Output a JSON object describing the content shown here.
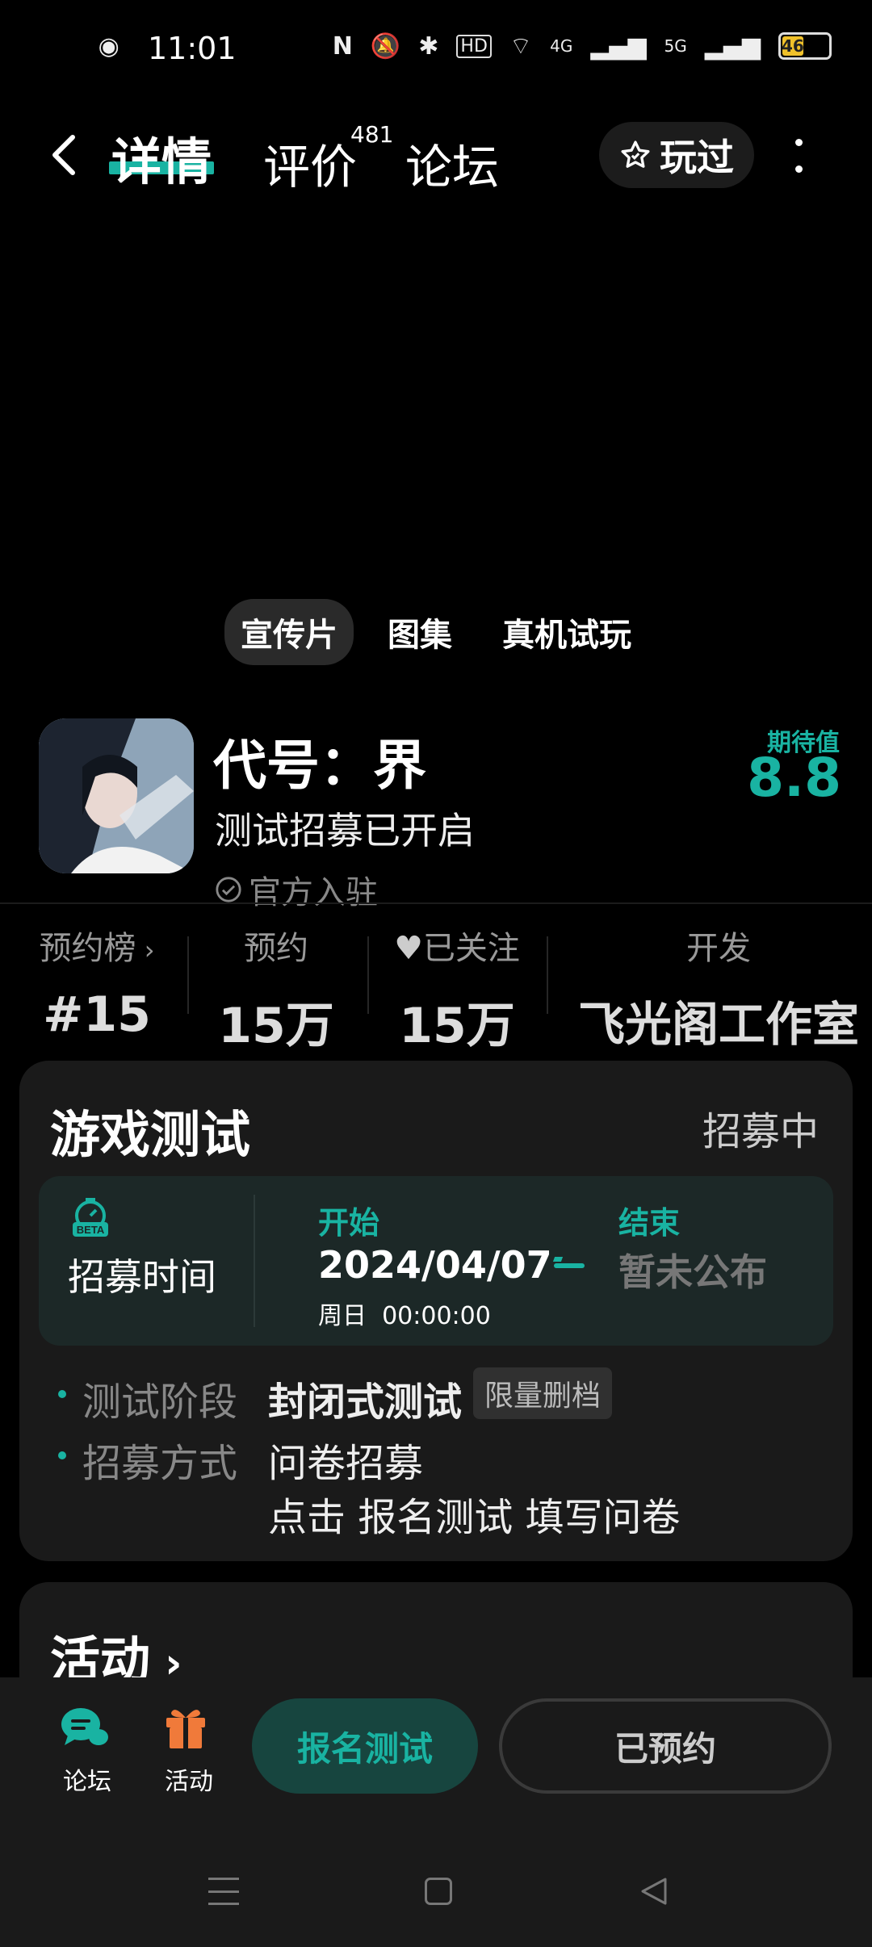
{
  "status_bar": {
    "time": "11:01",
    "battery": "46",
    "network_labels": [
      "HD",
      "4G",
      "5G"
    ]
  },
  "header": {
    "tabs": [
      {
        "label": "详情",
        "active": true
      },
      {
        "label": "评价",
        "count": "481"
      },
      {
        "label": "论坛"
      }
    ],
    "played_label": "玩过"
  },
  "media_tabs": [
    "宣传片",
    "图集",
    "真机试玩"
  ],
  "game": {
    "title": "代号：界",
    "subtitle": "测试招募已开启",
    "official": "官方入驻",
    "expect_label": "期待值",
    "expect_value": "8.8"
  },
  "stats": [
    {
      "label": "预约榜",
      "value": "#15",
      "chevron": true
    },
    {
      "label": "预约",
      "value": "15万"
    },
    {
      "label": "已关注",
      "value": "15万",
      "icon": "heart-icon"
    },
    {
      "label": "开发",
      "value": "飞光阁工作室"
    }
  ],
  "test_card": {
    "title": "游戏测试",
    "status": "招募中",
    "recruit_label": "招募时间",
    "beta_badge": "BETA",
    "start_label": "开始",
    "start_date": "2024/04/07",
    "start_time": "周日  00:00:00",
    "end_label": "结束",
    "end_date": "暂未公布",
    "stage_label": "测试阶段",
    "stage_value": "封闭式测试",
    "stage_tag": "限量删档",
    "method_label": "招募方式",
    "method_value": "问卷招募",
    "method_value2": "点击 报名测试 填写问卷"
  },
  "activity_card": {
    "title": "活动"
  },
  "bottom_bar": {
    "forum_label": "论坛",
    "activity_label": "活动",
    "signup_label": "报名测试",
    "reserved_label": "已预约"
  },
  "colors": {
    "accent": "#19b3a2",
    "background": "#000000",
    "card": "#1a1a1a"
  }
}
